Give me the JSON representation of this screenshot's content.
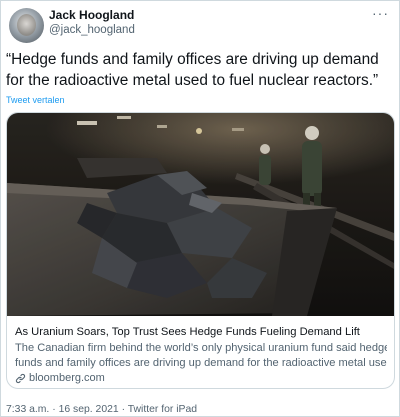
{
  "author": {
    "name": "Jack Hoogland",
    "handle": "@jack_hoogland"
  },
  "more_menu": "···",
  "tweet_text": "“Hedge funds and family offices are driving up demand for the radioactive metal used to fuel nuclear reactors.”",
  "translate_label": "Tweet vertalen",
  "card": {
    "title": "As Uranium Soars, Top Trust Sees Hedge Funds Fueling Demand Lift",
    "description_line1": "The Canadian firm behind the world’s only physical uranium fund said hedge",
    "description_line2": "funds and family offices are driving up demand for the radioactive metal used t...",
    "domain": "bloomberg.com",
    "image_subject": "mine-cart-with-ore-and-miners"
  },
  "meta": {
    "time": "7:33 a.m.",
    "separator": "·",
    "date": "16 sep. 2021",
    "source": "Twitter for iPad"
  },
  "colors": {
    "link": "#1d9bf0",
    "secondary_text": "#536471",
    "border": "#cfd9de"
  },
  "icons": {
    "link": "link-icon",
    "more": "more-icon",
    "avatar": "avatar"
  }
}
